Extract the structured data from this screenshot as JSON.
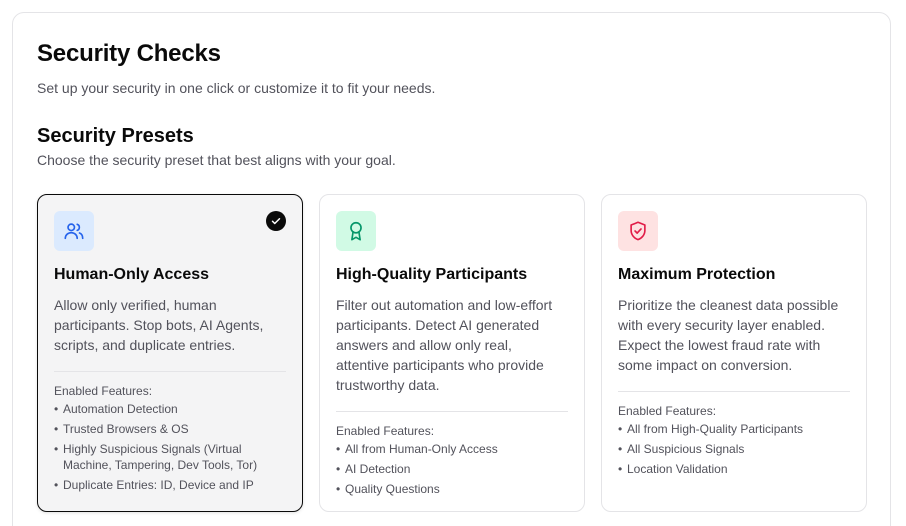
{
  "header": {
    "title": "Security Checks",
    "subtitle": "Set up your security in one click or customize it to fit your needs."
  },
  "presets": {
    "title": "Security Presets",
    "subtitle": "Choose the security preset that best aligns with your goal.",
    "features_label": "Enabled Features:",
    "cards": [
      {
        "title": "Human-Only Access",
        "description": "Allow only verified, human participants. Stop bots, AI Agents, scripts, and duplicate entries.",
        "icon": "users-icon",
        "selected": true,
        "features": [
          "Automation Detection",
          "Trusted Browsers & OS",
          "Highly Suspicious Signals (Virtual Machine, Tampering, Dev Tools, Tor)",
          "Duplicate Entries: ID, Device and IP"
        ]
      },
      {
        "title": "High-Quality Participants",
        "description": "Filter out automation and low-effort participants. Detect AI generated answers and allow only real, attentive participants who provide trustworthy data.",
        "icon": "award-icon",
        "selected": false,
        "features": [
          "All from Human-Only Access",
          "AI Detection",
          "Quality Questions"
        ]
      },
      {
        "title": "Maximum Protection",
        "description": "Prioritize the cleanest data possible with every security layer enabled. Expect the lowest fraud rate with some impact on conversion.",
        "icon": "shield-check-icon",
        "selected": false,
        "features": [
          "All from High-Quality Participants",
          "All Suspicious Signals",
          "Location Validation"
        ]
      }
    ]
  },
  "colors": {
    "blue_icon": "#2563eb",
    "green_icon": "#059669",
    "red_icon": "#e11d48",
    "selected_border": "#0a0a0a"
  }
}
